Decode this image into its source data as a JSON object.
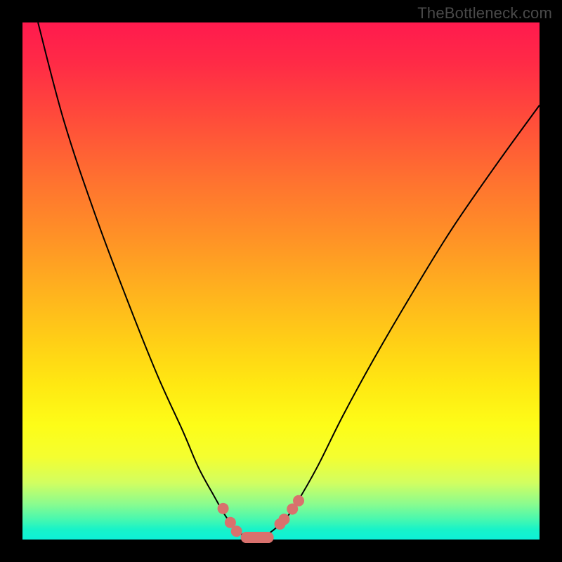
{
  "watermark": "TheBottleneck.com",
  "chart_data": {
    "type": "line",
    "title": "",
    "xlabel": "",
    "ylabel": "",
    "xlim": [
      0,
      100
    ],
    "ylim": [
      0,
      100
    ],
    "background_gradient": {
      "top_color": "#ff1a4e",
      "mid_color": "#ffe812",
      "bottom_color": "#0df0d8",
      "meaning": "bottleneck severity (red high, green low)"
    },
    "series": [
      {
        "name": "bottleneck-curve",
        "x": [
          3,
          8,
          14,
          20,
          26,
          31,
          34,
          37,
          39.5,
          41.5,
          43,
          44.5,
          46.5,
          48.5,
          51,
          53,
          57,
          62,
          68,
          75,
          83,
          92,
          100
        ],
        "y": [
          100,
          81,
          63,
          47,
          32,
          21,
          14,
          8.5,
          4.2,
          1.8,
          0.6,
          0.2,
          0.6,
          1.8,
          4.2,
          7,
          14,
          24,
          35,
          47,
          60,
          73,
          84
        ],
        "note": "y = estimated bottleneck percentage; minimum (optimal match) near x≈44"
      }
    ],
    "markers": {
      "name": "near-optimal-points",
      "color": "#d9716d",
      "points": [
        {
          "x": 38.8,
          "y": 6.0
        },
        {
          "x": 40.2,
          "y": 3.3
        },
        {
          "x": 41.4,
          "y": 1.6
        },
        {
          "x": 49.8,
          "y": 3.0
        },
        {
          "x": 50.6,
          "y": 3.9
        },
        {
          "x": 52.2,
          "y": 5.9
        },
        {
          "x": 53.4,
          "y": 7.5
        }
      ],
      "flat_min_segment": {
        "x_start": 42.2,
        "x_end": 48.6,
        "y": 0.4
      }
    }
  }
}
